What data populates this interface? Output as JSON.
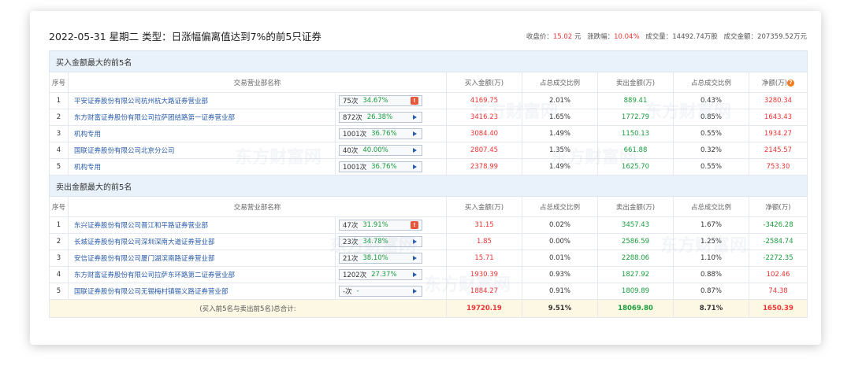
{
  "title": "2022-05-31 星期二 类型：日涨幅偏离值达到7%的前5只证券",
  "stats": {
    "close_label": "收盘价：",
    "close_value": "15.02",
    "close_unit": "元",
    "change_label": "涨跌幅：",
    "change_value": "10.04%",
    "volume_label": "成交量：",
    "volume_value": "14492.74万股",
    "turnover_label": "成交金额：",
    "turnover_value": "207359.52万元"
  },
  "columns": {
    "seq": "序号",
    "dept": "交易营业部名称",
    "buy": "买入金额(万)",
    "buy_ratio": "占总成交比例",
    "sell": "卖出金额(万)",
    "sell_ratio": "占总成交比例",
    "net": "净额(万)"
  },
  "buy_section": {
    "title": "买入金额最大的前5名",
    "rows": [
      {
        "seq": "1",
        "name": "平安证券股份有限公司杭州杭大路证券营业部",
        "count": "75次",
        "pct": "34.67%",
        "icon": "warning-icon",
        "buy": "4169.75",
        "buy_ratio": "2.01%",
        "sell": "889.41",
        "sell_ratio": "0.43%",
        "net": "3280.34"
      },
      {
        "seq": "2",
        "name": "东方财富证券股份有限公司拉萨团结路第一证券营业部",
        "count": "872次",
        "pct": "26.38%",
        "icon": "arrow-right-icon",
        "buy": "3416.23",
        "buy_ratio": "1.65%",
        "sell": "1772.79",
        "sell_ratio": "0.85%",
        "net": "1643.43"
      },
      {
        "seq": "3",
        "name": "机构专用",
        "count": "1001次",
        "pct": "36.76%",
        "icon": "arrow-right-icon",
        "buy": "3084.40",
        "buy_ratio": "1.49%",
        "sell": "1150.13",
        "sell_ratio": "0.55%",
        "net": "1934.27"
      },
      {
        "seq": "4",
        "name": "国联证券股份有限公司北京分公司",
        "count": "40次",
        "pct": "40.00%",
        "icon": "arrow-right-icon",
        "buy": "2807.45",
        "buy_ratio": "1.35%",
        "sell": "661.88",
        "sell_ratio": "0.32%",
        "net": "2145.57"
      },
      {
        "seq": "5",
        "name": "机构专用",
        "count": "1001次",
        "pct": "36.76%",
        "icon": "arrow-right-icon",
        "buy": "2378.99",
        "buy_ratio": "1.49%",
        "sell": "1625.70",
        "sell_ratio": "0.55%",
        "net": "753.30"
      }
    ]
  },
  "sell_section": {
    "title": "卖出金额最大的前5名",
    "rows": [
      {
        "seq": "1",
        "name": "东兴证券股份有限公司晋江和平路证券营业部",
        "count": "47次",
        "pct": "31.91%",
        "icon": "warning-icon",
        "buy": "31.15",
        "buy_ratio": "0.02%",
        "sell": "3457.43",
        "sell_ratio": "1.67%",
        "net": "-3426.28"
      },
      {
        "seq": "2",
        "name": "长城证券股份有限公司深圳深南大道证券营业部",
        "count": "23次",
        "pct": "34.78%",
        "icon": "arrow-right-icon",
        "buy": "1.85",
        "buy_ratio": "0.00%",
        "sell": "2586.59",
        "sell_ratio": "1.25%",
        "net": "-2584.74"
      },
      {
        "seq": "3",
        "name": "安信证券股份有限公司厦门湖滨南路证券营业部",
        "count": "21次",
        "pct": "38.10%",
        "icon": "arrow-right-icon",
        "buy": "15.71",
        "buy_ratio": "0.01%",
        "sell": "2288.06",
        "sell_ratio": "1.10%",
        "net": "-2272.35"
      },
      {
        "seq": "4",
        "name": "东方财富证券股份有限公司拉萨东环路第二证券营业部",
        "count": "1202次",
        "pct": "27.37%",
        "icon": "arrow-right-icon",
        "buy": "1930.39",
        "buy_ratio": "0.93%",
        "sell": "1827.92",
        "sell_ratio": "0.88%",
        "net": "102.46"
      },
      {
        "seq": "5",
        "name": "国联证券股份有限公司无锡梅村镇锡义路证券营业部",
        "count": "-次",
        "pct": "-",
        "icon": "arrow-right-icon",
        "buy": "1884.27",
        "buy_ratio": "0.91%",
        "sell": "1809.89",
        "sell_ratio": "0.87%",
        "net": "74.38"
      }
    ]
  },
  "total": {
    "label": "(买入前5名与卖出前5名)总合计:",
    "buy": "19720.19",
    "buy_ratio": "9.51%",
    "sell": "18069.80",
    "sell_ratio": "8.71%",
    "net": "1650.39"
  },
  "watermark": "东方财富网",
  "colors": {
    "positive": "#e33333",
    "negative": "#1a9c3c",
    "link": "#2a5caa",
    "section_bg": "#e9f2fb",
    "total_bg": "#fdf8e4"
  }
}
